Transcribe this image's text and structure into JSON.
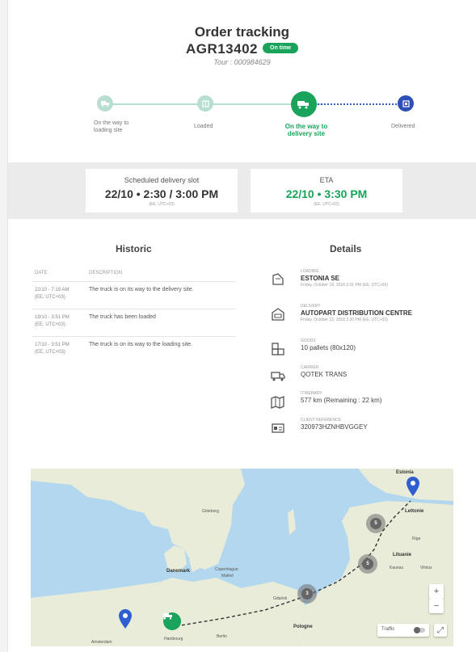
{
  "header": {
    "title": "Order tracking",
    "order_id": "AGR13402",
    "badge": "On time",
    "tour": "Tour : 000984629"
  },
  "steps": [
    {
      "label_l1": "On the way to",
      "label_l2": "loading site",
      "state": "done"
    },
    {
      "label_l1": "Loaded",
      "label_l2": "",
      "state": "done"
    },
    {
      "label_l1": "On the way to",
      "label_l2": "delivery site",
      "state": "current"
    },
    {
      "label_l1": "Delivered",
      "label_l2": "",
      "state": "pending"
    }
  ],
  "slots": {
    "scheduled": {
      "title": "Scheduled delivery slot",
      "value": "22/10 • 2:30 / 3:00 PM",
      "tz": "(EE, UTC+03)"
    },
    "eta": {
      "title": "ETA",
      "value": "22/10 • 3:30 PM",
      "tz": "(EE, UTC+03)"
    }
  },
  "historic": {
    "title": "Historic",
    "col_date": "DATE",
    "col_desc": "DESCRIPTION",
    "rows": [
      {
        "date": "22/10 - 7:19 AM",
        "tz": "(EE, UTC+03)",
        "desc": "The truck is on its way to the delivery site."
      },
      {
        "date": "19/10 - 3:51 PM",
        "tz": "(EE, UTC+03)",
        "desc": "The truck has been loaded"
      },
      {
        "date": "17/10 - 3:51 PM",
        "tz": "(EE, UTC+03)",
        "desc": "The truck is on its way to the loading site."
      }
    ]
  },
  "details": {
    "title": "Details",
    "items": [
      {
        "icon": "loading-icon",
        "caption": "LOADING",
        "value": "ESTONIA SE",
        "sub": "Friday, October 19, 2018 2:31 PM (EE, UTC+03)",
        "bold": true
      },
      {
        "icon": "delivery-icon",
        "caption": "DELIVERY",
        "value": "AUTOPART DISTRIBUTION CENTRE",
        "sub": "Friday, October 22, 2018 2:30 PM (EE, UTC+03)",
        "bold": true
      },
      {
        "icon": "goods-icon",
        "caption": "GOODS",
        "value": "10 pallets (80x120)",
        "sub": "",
        "bold": false
      },
      {
        "icon": "carrier-icon",
        "caption": "CARRIER",
        "value": "QOTEK TRANS",
        "sub": "",
        "bold": false
      },
      {
        "icon": "itinerary-icon",
        "caption": "ITINERARY",
        "value": "577 km (Remaining : 22 km)",
        "sub": "",
        "bold": false
      },
      {
        "icon": "client-reference-icon",
        "caption": "CLIENT REFERENCE",
        "value": "320973HZNHBVGGEY",
        "sub": "",
        "bold": false
      }
    ]
  },
  "map": {
    "labels": {
      "estonia": "Estonia",
      "lettonie": "Lettonie",
      "lituanie": "Lituanie",
      "danemark": "Danemark",
      "pologne": "Pologne",
      "copenhague": "Copenhague",
      "malmo": "Malmö",
      "goteborg": "Göteborg",
      "hambourg": "Hambourg",
      "amsterdam": "Amsterdam",
      "riga": "Riga",
      "vilnius": "Vilnius",
      "kaunas": "Kaunas",
      "gdansk": "Gdańsk",
      "berlin": "Berlin"
    },
    "clusters": [
      "5",
      "5",
      "3"
    ],
    "traffic_label": "Traffic",
    "zoom_in": "+",
    "zoom_out": "−",
    "fullscreen": "⤢"
  }
}
